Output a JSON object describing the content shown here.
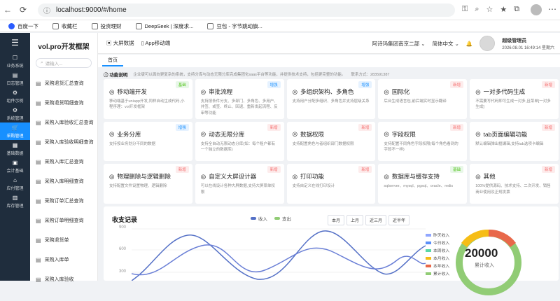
{
  "browser": {
    "url": "localhost:9000/#/home"
  },
  "bookmarks": [
    {
      "label": "百度一下",
      "icon": "baidu-icon"
    },
    {
      "label": "收藏栏",
      "icon": "folder-icon"
    },
    {
      "label": "投资理财",
      "icon": "folder-icon"
    },
    {
      "label": "DeepSeek | 深度求...",
      "icon": "deepseek-icon"
    },
    {
      "label": "豆包 - 字节跳动旗...",
      "icon": "doubao-icon"
    }
  ],
  "sidebar": {
    "items": [
      {
        "label": "业务系统"
      },
      {
        "label": "日志管理"
      },
      {
        "label": "组件示例"
      },
      {
        "label": "系统管理"
      },
      {
        "label": "采购管理"
      },
      {
        "label": "基础数据"
      },
      {
        "label": "会计基础"
      },
      {
        "label": "应付管理"
      },
      {
        "label": "库存管理"
      }
    ]
  },
  "submenu": {
    "title": "vol.pro开发框架",
    "search_placeholder": "请输入...",
    "items": [
      {
        "label": "采购退货汇总查询"
      },
      {
        "label": "采购退货明细查询"
      },
      {
        "label": "采购入库验收汇总查询"
      },
      {
        "label": "采购入库验收明细查询"
      },
      {
        "label": "采购入库汇总查询"
      },
      {
        "label": "采购入库明细查询"
      },
      {
        "label": "采购订单汇总查询"
      },
      {
        "label": "采购订单明细查询"
      },
      {
        "label": "采购退货单"
      },
      {
        "label": "采购入库单"
      },
      {
        "label": "采购入库验收"
      }
    ]
  },
  "topbar": {
    "links": [
      "大屏数据",
      "App移动端"
    ],
    "company": "阿诗玛集团南京二部",
    "lang": "简体中文",
    "username": "超级管理员",
    "datetime": "2026.08.01 16:49:14 星期六"
  },
  "tabs": [
    "首页"
  ],
  "func": {
    "title": "功能说明",
    "desc": "企业版可以面向更复杂的系统，支持分库与动态无限分库完成集团化saas平台等功能，并提供技术支持，包括更完整的功能。",
    "contact": "联系方式：283591387"
  },
  "cards": [
    {
      "title": "移动端开发",
      "desc": "移动端基于uniapp开发,同样自动生成代码,小程序理：vol开发框架",
      "badge": "基础",
      "badge_color": "green",
      "icon": "phone-icon"
    },
    {
      "title": "审批流程",
      "desc": "支持按条件分支、多部门、多角色、多用户、并签、或签、终止、回退、重新发起流程、反审等功能",
      "badge": "增强",
      "badge_color": "blue",
      "icon": "flow-icon"
    },
    {
      "title": "多组织架构、多角色",
      "desc": "支持用户分配多组织、多角色并支持层级关系",
      "badge": "增强",
      "badge_color": "blue",
      "icon": "org-icon"
    },
    {
      "title": "国际化",
      "desc": "后台生成语言包,前后端实时显示翻译",
      "badge": "新增",
      "badge_color": "red",
      "icon": "globe-icon"
    },
    {
      "title": "一对多代码生成",
      "desc": "不需要写代码即可生成一对多,且菜单[一对多生成]",
      "badge": "新增",
      "badge_color": "red",
      "icon": "code-icon"
    },
    {
      "title": "业务分库",
      "desc": "支持按业务划分不同的数据",
      "badge": "增强",
      "badge_color": "blue",
      "icon": "database-icon"
    },
    {
      "title": "动态无限分库",
      "desc": "支持全自动无限动态分库(如：每个租户都有一个独立的数据库)",
      "badge": "新增",
      "badge_color": "red",
      "icon": "server-icon"
    },
    {
      "title": "数据权限",
      "desc": "支持配置角色与者组织部门数据权限",
      "badge": "新增",
      "badge_color": "red",
      "icon": "lock-icon"
    },
    {
      "title": "字段权限",
      "desc": "支持配置不同角色字段权限(每个角色看到的字段不一样)",
      "badge": "新增",
      "badge_color": "red",
      "icon": "field-icon"
    },
    {
      "title": "tab页面编辑功能",
      "desc": "默认编辑弹出框编辑,支持tab选项卡编辑",
      "badge": "新增",
      "badge_color": "red",
      "icon": "tab-icon"
    },
    {
      "title": "物理删除与逻辑删除",
      "desc": "支持配置文件设置物理、逻辑删除",
      "badge": "新增",
      "badge_color": "red",
      "icon": "delete-icon"
    },
    {
      "title": "自定义大屏设计器",
      "desc": "可以在线设计各种大屏数据,支持大屏菜单权限",
      "badge": "新增",
      "badge_color": "red",
      "icon": "screen-icon"
    },
    {
      "title": "打印功能",
      "desc": "支持自定义在线打印设计",
      "badge": "新增",
      "badge_color": "red",
      "icon": "print-icon"
    },
    {
      "title": "数据库与缓存支持",
      "desc": "sqlserver、mysql、pgsql、oracle、redis",
      "badge": "基础",
      "badge_color": "green",
      "icon": "db-cache-icon"
    },
    {
      "title": "其他",
      "desc": "100%提供源码、技术支持、二次开发、销售商业使用及正规发票",
      "badge": "新增",
      "badge_color": "red",
      "icon": "other-icon"
    }
  ],
  "chart": {
    "title": "收支记录",
    "legend": [
      "收入",
      "支出"
    ],
    "periods": [
      "本月",
      "上月",
      "近三月",
      "近半年"
    ],
    "yticks": [
      "900",
      "600",
      "300"
    ]
  },
  "chart_data": {
    "type": "line",
    "series": [
      {
        "name": "收入",
        "color": "#5470c6"
      },
      {
        "name": "支出",
        "color": "#91cc75"
      }
    ],
    "ylim": [
      0,
      900
    ]
  },
  "donut": {
    "value": "20000",
    "label": "累计收入",
    "legend": [
      {
        "label": "昨天收入",
        "color": "#91a7ff"
      },
      {
        "label": "今日收入",
        "color": "#5b8ff9"
      },
      {
        "label": "本周收入",
        "color": "#5ad8a6"
      },
      {
        "label": "本月收入",
        "color": "#f6bd16"
      },
      {
        "label": "本年收入",
        "color": "#e8684a"
      },
      {
        "label": "累计收入",
        "color": "#91cc75"
      }
    ]
  }
}
